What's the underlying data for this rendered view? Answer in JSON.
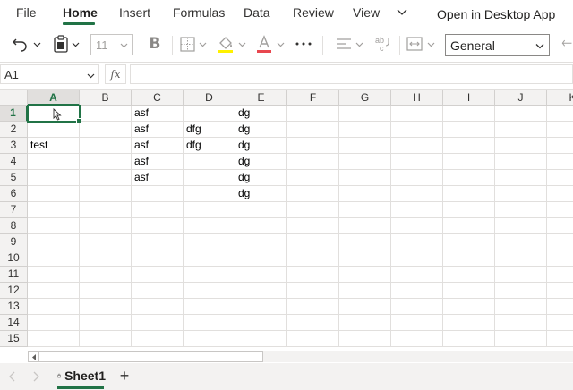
{
  "menu": {
    "tabs": [
      {
        "label": "File"
      },
      {
        "label": "Home",
        "active": true
      },
      {
        "label": "Insert"
      },
      {
        "label": "Formulas"
      },
      {
        "label": "Data"
      },
      {
        "label": "Review"
      },
      {
        "label": "View"
      }
    ],
    "open_desktop_label": "Open in Desktop App",
    "more_icon": "chevron-down-icon"
  },
  "toolbar": {
    "font_size": "11",
    "bold_label": "B",
    "number_format": "General",
    "font_color": "#e8474f",
    "highlight_color": "#fff100",
    "icons": [
      "undo-icon",
      "paste-icon",
      "borders-icon",
      "fill-color-icon",
      "font-color-icon",
      "more-icon",
      "align-icon",
      "wrap-text-icon",
      "merge-icon",
      "redo-icon"
    ]
  },
  "formula_bar": {
    "name_box": "A1",
    "fx_label": "fx",
    "value": ""
  },
  "grid": {
    "columns": [
      "A",
      "B",
      "C",
      "D",
      "E",
      "F",
      "G",
      "H",
      "I",
      "J",
      "K"
    ],
    "rows": [
      "1",
      "2",
      "3",
      "4",
      "5",
      "6",
      "7",
      "8",
      "9",
      "10",
      "11",
      "12",
      "13",
      "14",
      "15"
    ],
    "selected_cell": "A1",
    "cells": [
      {
        "ref": "C1",
        "value": "asf"
      },
      {
        "ref": "E1",
        "value": "dg"
      },
      {
        "ref": "C2",
        "value": "asf"
      },
      {
        "ref": "D2",
        "value": "dfg"
      },
      {
        "ref": "E2",
        "value": "dg"
      },
      {
        "ref": "A3",
        "value": "test"
      },
      {
        "ref": "C3",
        "value": "asf"
      },
      {
        "ref": "D3",
        "value": "dfg"
      },
      {
        "ref": "E3",
        "value": "dg"
      },
      {
        "ref": "C4",
        "value": "asf"
      },
      {
        "ref": "E4",
        "value": "dg"
      },
      {
        "ref": "C5",
        "value": "asf"
      },
      {
        "ref": "E5",
        "value": "dg"
      },
      {
        "ref": "E6",
        "value": "dg"
      }
    ]
  },
  "sheets": {
    "tabs": [
      {
        "label": "Sheet1",
        "active": true,
        "icon": "lock-icon"
      }
    ],
    "add_label": "+"
  },
  "colors": {
    "accent": "#217346",
    "header_bg": "#f3f2f1"
  }
}
